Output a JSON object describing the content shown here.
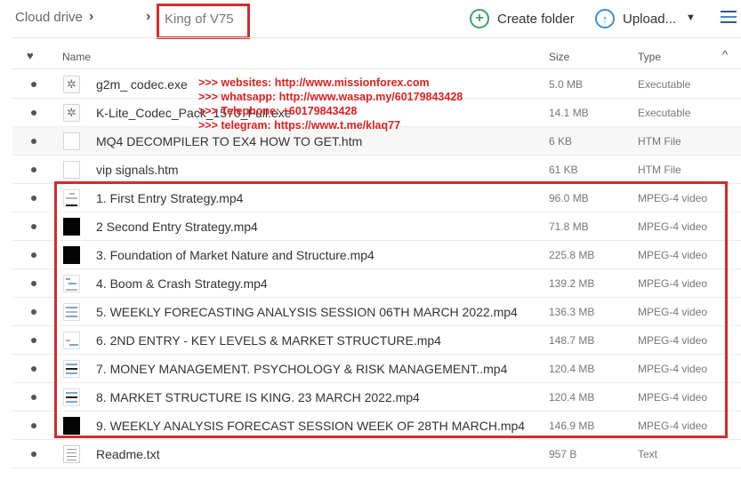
{
  "breadcrumb": {
    "root": "Cloud drive",
    "separator": "›",
    "current": "King of V75"
  },
  "toolbar": {
    "create_folder": "Create folder",
    "upload": "Upload...",
    "upload_caret": "⌄",
    "create_icon": "plus-circle-icon",
    "upload_icon": "upload-circle-icon",
    "view_icon": "list-view-icon"
  },
  "columns": {
    "favorite_icon": "♥",
    "name": "Name",
    "size": "Size",
    "type": "Type",
    "sort_indicator": "^"
  },
  "promo_lines": [
    ">>> websites: http://www.missionforex.com",
    ">>> whatsapp: http://www.wasap.my/60179843428",
    ">>> Telephone: +60179843428",
    ">>> telegram: https://www.t.me/klaq77"
  ],
  "files": [
    {
      "name": "g2m_ codec.exe",
      "size": "5.0 MB",
      "type": "Executable",
      "icon": "exe-gear-icon"
    },
    {
      "name": "K-Lite_Codec_Pack_1570_Full.exe",
      "size": "14.1 MB",
      "type": "Executable",
      "icon": "exe-gear-icon"
    },
    {
      "name": "MQ4 DECOMPILER TO EX4 HOW TO GET.htm",
      "size": "6 KB",
      "type": "HTM File",
      "icon": "html-file-icon"
    },
    {
      "name": "vip signals.htm",
      "size": "61 KB",
      "type": "HTM File",
      "icon": "html-file-icon"
    },
    {
      "name": "1. First Entry Strategy.mp4",
      "size": "96.0 MB",
      "type": "MPEG-4 video",
      "icon": "video-thumbnail-icon"
    },
    {
      "name": "2 Second Entry Strategy.mp4",
      "size": "71.8 MB",
      "type": "MPEG-4 video",
      "icon": "video-thumbnail-icon"
    },
    {
      "name": "3. Foundation of Market Nature and Structure.mp4",
      "size": "225.8 MB",
      "type": "MPEG-4 video",
      "icon": "video-thumbnail-icon"
    },
    {
      "name": "4. Boom & Crash Strategy.mp4",
      "size": "139.2 MB",
      "type": "MPEG-4 video",
      "icon": "video-thumbnail-icon"
    },
    {
      "name": "5. WEEKLY FORECASTING ANALYSIS SESSION 06TH MARCH 2022.mp4",
      "size": "136.3 MB",
      "type": "MPEG-4 video",
      "icon": "video-thumbnail-icon"
    },
    {
      "name": "6. 2ND ENTRY - KEY LEVELS & MARKET STRUCTURE.mp4",
      "size": "148.7 MB",
      "type": "MPEG-4 video",
      "icon": "video-thumbnail-icon"
    },
    {
      "name": "7. MONEY MANAGEMENT. PSYCHOLOGY & RISK MANAGEMENT..mp4",
      "size": "120.4 MB",
      "type": "MPEG-4 video",
      "icon": "video-thumbnail-icon"
    },
    {
      "name": "8. MARKET STRUCTURE IS KING. 23 MARCH 2022.mp4",
      "size": "120.4 MB",
      "type": "MPEG-4 video",
      "icon": "video-thumbnail-icon"
    },
    {
      "name": "9. WEEKLY ANALYSIS FORECAST SESSION WEEK OF 28TH MARCH.mp4",
      "size": "146.9 MB",
      "type": "MPEG-4 video",
      "icon": "video-thumbnail-icon"
    },
    {
      "name": "Readme.txt",
      "size": "957 B",
      "type": "Text",
      "icon": "text-file-icon"
    }
  ]
}
